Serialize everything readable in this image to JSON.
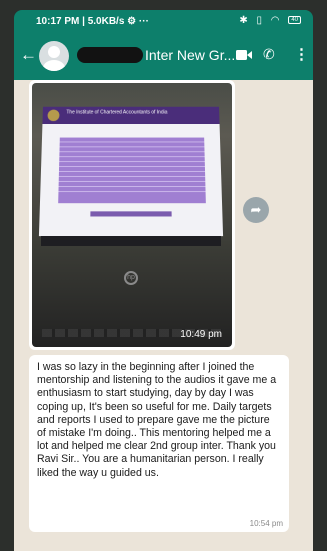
{
  "status_bar": {
    "left": "10:17 PM | 5.0KB/s ⚙ ···",
    "right_icons": [
      "bluetooth-icon",
      "vibrate-icon",
      "wifi-icon",
      "battery-icon"
    ],
    "battery": "40"
  },
  "header": {
    "title": "Inter New Gr...",
    "icons": [
      "back-arrow-icon",
      "avatar",
      "video-call-icon",
      "phone-call-icon",
      "more-vert-icon"
    ],
    "colors": {
      "header_bg": "#0d7f6b",
      "chat_bg": "#ebe4d9"
    }
  },
  "messages": [
    {
      "type": "image",
      "time": "10:49 pm",
      "photo_screen_title": "The Institute of Chartered Accountants of India"
    },
    {
      "type": "text",
      "text": "I was so lazy in the beginning after I joined the mentorship and listening to the audios it gave me a enthusiasm to start studying, day by day I was coping up, It's been so useful for me. Daily targets and reports I used to prepare gave me the picture of mistake I'm doing.. This mentoring helped me a lot and helped me clear 2nd group inter. Thank you Ravi Sir.. You are a humanitarian person. I really liked the way u guided us.",
      "time": "10:54 pm"
    }
  ]
}
